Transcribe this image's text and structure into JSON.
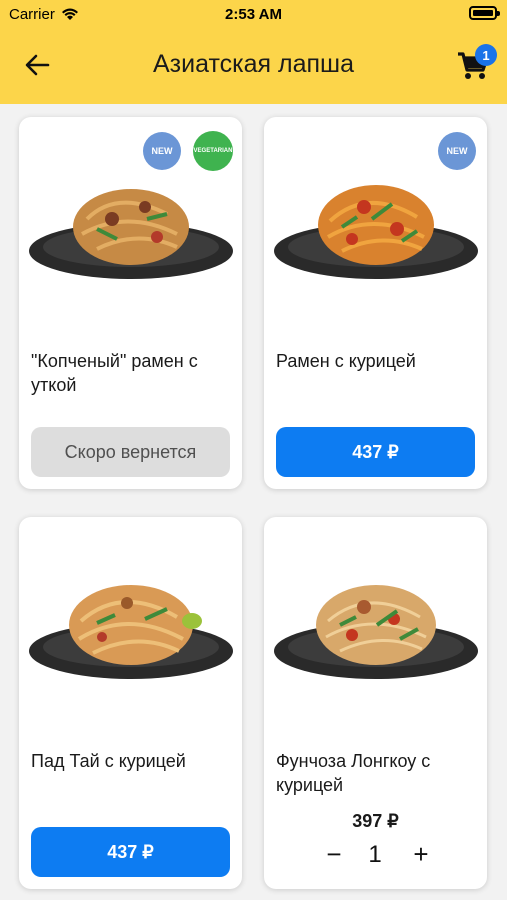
{
  "status_bar": {
    "carrier": "Carrier",
    "time": "2:53 AM"
  },
  "header": {
    "title": "Азиатская лапша",
    "cart_count": "1"
  },
  "colors": {
    "header_bg": "#fcd54a",
    "accent": "#0d7cf2",
    "new_badge": "#6b96d6",
    "veg_badge": "#3fb34f"
  },
  "badges": {
    "new": "NEW",
    "vegetarian": "VEGETARIAN"
  },
  "products": [
    {
      "name": "\"Копченый\" рамен с уткой",
      "button": "Скоро вернется",
      "badges": [
        "new",
        "vegetarian"
      ]
    },
    {
      "name": "Рамен с курицей",
      "button": "437 ₽",
      "badges": [
        "new"
      ]
    },
    {
      "name": "Пад Тай с курицей",
      "button": "437 ₽",
      "badges": []
    },
    {
      "name": "Фунчоза Лонгкоу с курицей",
      "price": "397 ₽",
      "quantity": "1",
      "badges": []
    }
  ],
  "stepper": {
    "minus": "−",
    "plus": "+"
  }
}
